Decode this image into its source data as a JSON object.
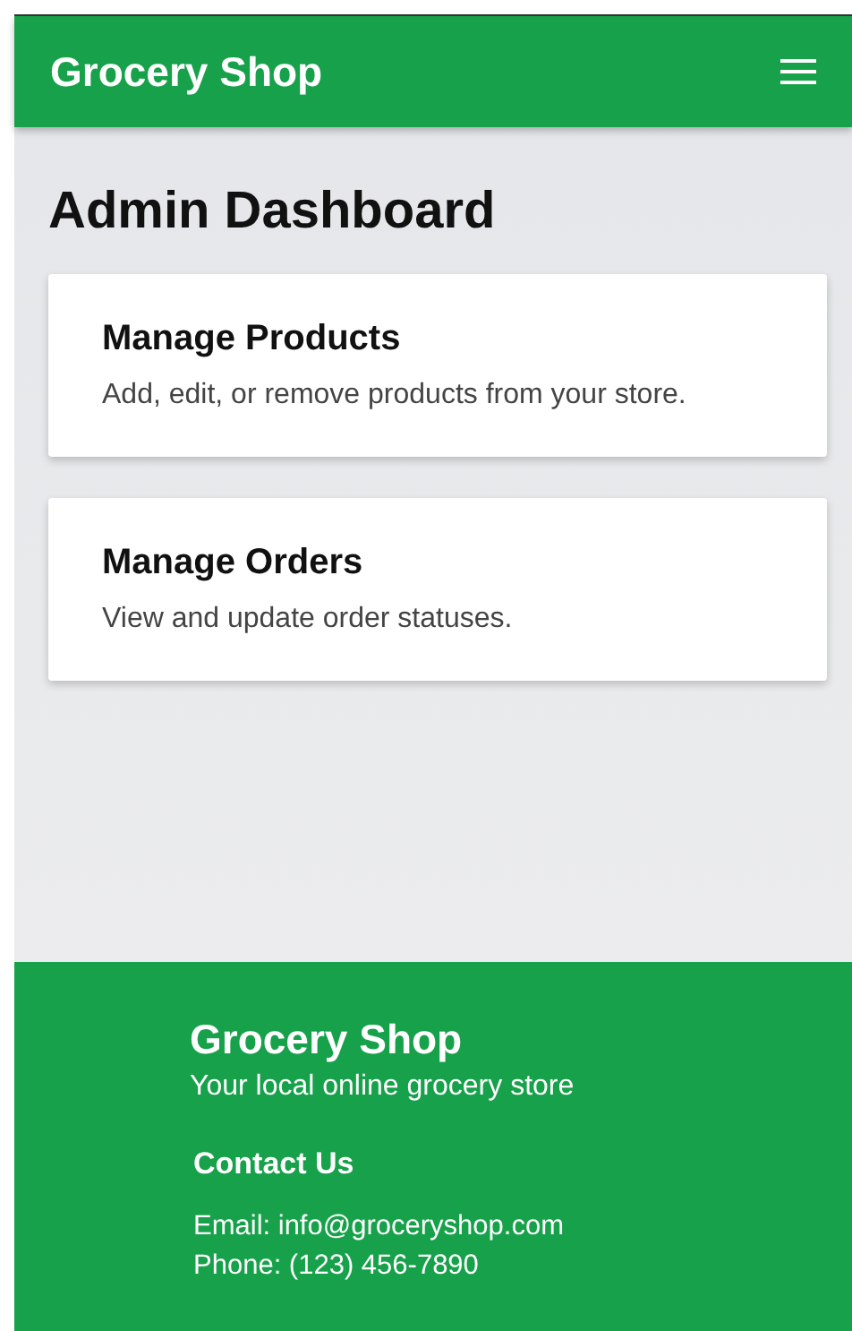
{
  "navbar": {
    "brand": "Grocery Shop"
  },
  "page_title": "Admin Dashboard",
  "cards": [
    {
      "title": "Manage Products",
      "text": "Add, edit, or remove products from your store."
    },
    {
      "title": "Manage Orders",
      "text": "View and update order statuses."
    }
  ],
  "footer": {
    "brand": "Grocery Shop",
    "tagline": "Your local online grocery store",
    "contact_heading": "Contact Us",
    "lines": [
      "Email: info@groceryshop.com",
      "Phone: (123) 456-7890"
    ]
  }
}
